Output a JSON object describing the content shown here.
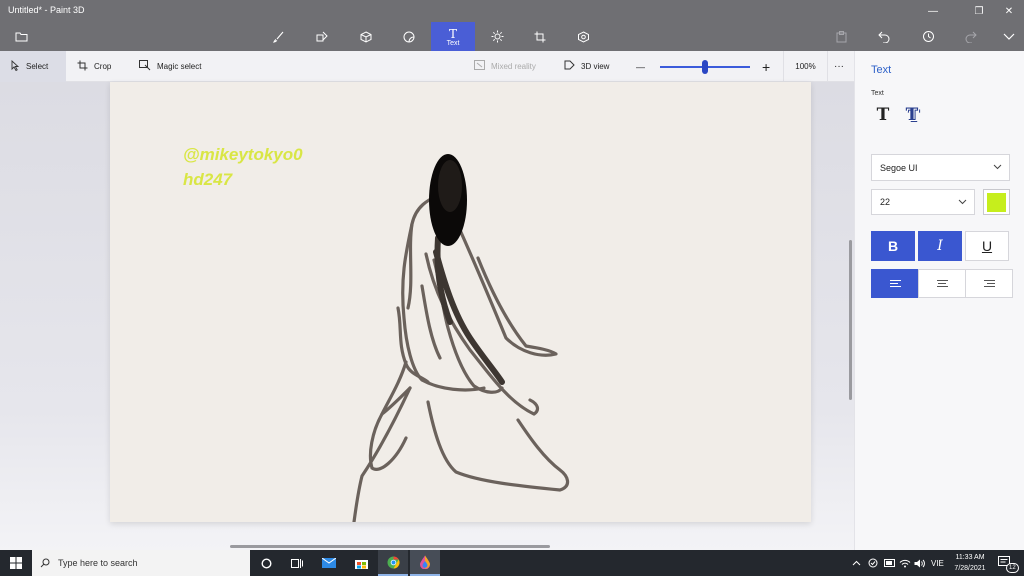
{
  "window": {
    "title": "Untitled* - Paint 3D",
    "controls": [
      "—",
      "❐",
      "✕"
    ]
  },
  "toolbar": {
    "active_label": "Text"
  },
  "subtoolbar": {
    "select": "Select",
    "crop": "Crop",
    "magic_select": "Magic select",
    "mixed_reality": "Mixed reality",
    "view_3d": "3D view",
    "zoom_minus": "—",
    "zoom_plus": "+",
    "zoom_level": "100%",
    "zoom_fraction": 0.5,
    "more": "···"
  },
  "canvas": {
    "text_line1": "@mikeytokyo0",
    "text_line2": "hd247",
    "text_color": "#d9e645"
  },
  "panel": {
    "title": "Text",
    "section_label": "Text",
    "text_2d_icon": "T",
    "text_3d_icon": "T",
    "font": "Segoe UI",
    "size": "22",
    "color": "#c6ee1c",
    "bold": "B",
    "italic": "I",
    "underline": "U",
    "align": "left",
    "accent": "#3a57d0"
  },
  "taskbar": {
    "search_placeholder": "Type here to search",
    "language": "VIE",
    "time": "11:33 AM",
    "date": "7/28/2021",
    "notification_count": "12"
  }
}
